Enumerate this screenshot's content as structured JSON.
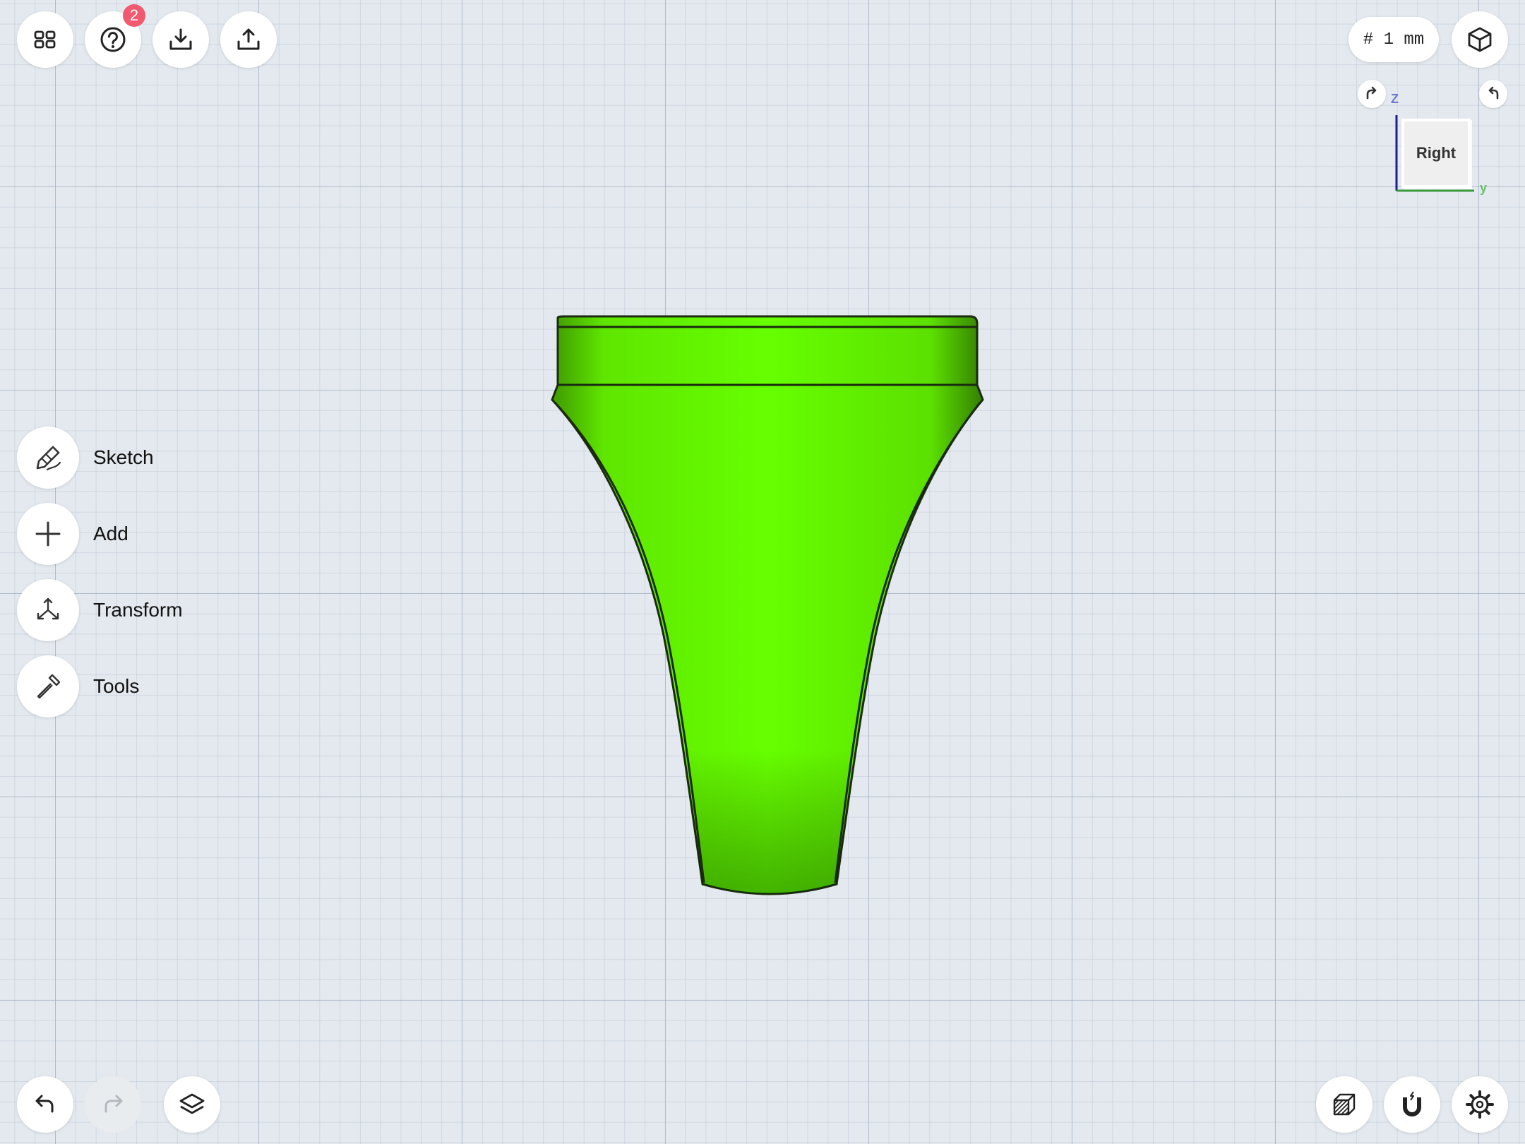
{
  "toolbar": {
    "help_badge_count": "2"
  },
  "units": {
    "label": "# 1 mm"
  },
  "view_cube": {
    "face_label": "Right",
    "z_axis_label": "Z",
    "y_axis_label": "y",
    "z_axis_color": "#1d1f8c",
    "y_axis_color": "#3a9a3a"
  },
  "left_menu": {
    "items": [
      {
        "label": "Sketch",
        "icon": "sketch-pen-icon"
      },
      {
        "label": "Add",
        "icon": "plus-icon"
      },
      {
        "label": "Transform",
        "icon": "transform-arrows-icon"
      },
      {
        "label": "Tools",
        "icon": "hammer-icon"
      }
    ]
  },
  "model": {
    "color": "#66ff00",
    "edge_color": "#1b2a10"
  },
  "bottom_left": {
    "undo": "undo-icon",
    "redo": "redo-icon",
    "layers": "layers-icon"
  },
  "bottom_right": {
    "section": "section-view-icon",
    "snap": "magnet-snap-icon",
    "settings": "gear-icon"
  }
}
